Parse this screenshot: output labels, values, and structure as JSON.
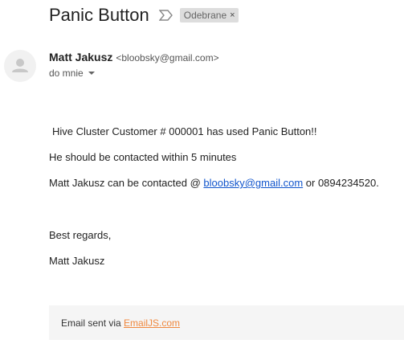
{
  "subject": "Panic Button",
  "label_chip": {
    "text": "Odebrane",
    "close": "×"
  },
  "sender": {
    "name": "Matt Jakusz",
    "email": "<bloobsky@gmail.com>"
  },
  "recipient": {
    "text": "do mnie"
  },
  "body": {
    "line1": "Hive Cluster Customer # 000001 has used Panic Button!!",
    "line2": "He should be contacted within 5 minutes",
    "line3_prefix": "Matt Jakusz can be contacted @ ",
    "line3_link": "bloobsky@gmail.com",
    "line3_suffix": " or 0894234520.",
    "regards": "Best regards,",
    "signature": "Matt Jakusz"
  },
  "footer": {
    "prefix": "Email sent via ",
    "link": "EmailJS.com"
  },
  "colors": {
    "link": "#1155cc",
    "footer_link": "#f0883e",
    "chip_bg": "#dddddd"
  },
  "icons": {
    "importance": "importance-marker-icon",
    "avatar": "person-icon",
    "dropdown": "caret-down-icon"
  }
}
